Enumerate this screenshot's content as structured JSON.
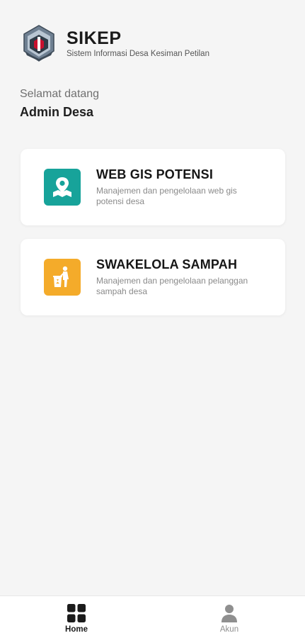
{
  "app": {
    "title": "SIKEP",
    "subtitle": "Sistem Informasi Desa Kesiman Petilan"
  },
  "welcome": {
    "greeting": "Selamat datang",
    "user": "Admin Desa"
  },
  "cards": [
    {
      "title": "WEB GIS POTENSI",
      "description": "Manajemen dan pengelolaan web gis potensi desa",
      "icon": "map-pin-icon",
      "color": "#17a39a"
    },
    {
      "title": "SWAKELOLA SAMPAH",
      "description": "Manajemen dan pengelolaan pelanggan sampah desa",
      "icon": "trash-person-icon",
      "color": "#f4ab2a"
    }
  ],
  "nav": {
    "home_label": "Home",
    "akun_label": "Akun",
    "active": "Home"
  }
}
